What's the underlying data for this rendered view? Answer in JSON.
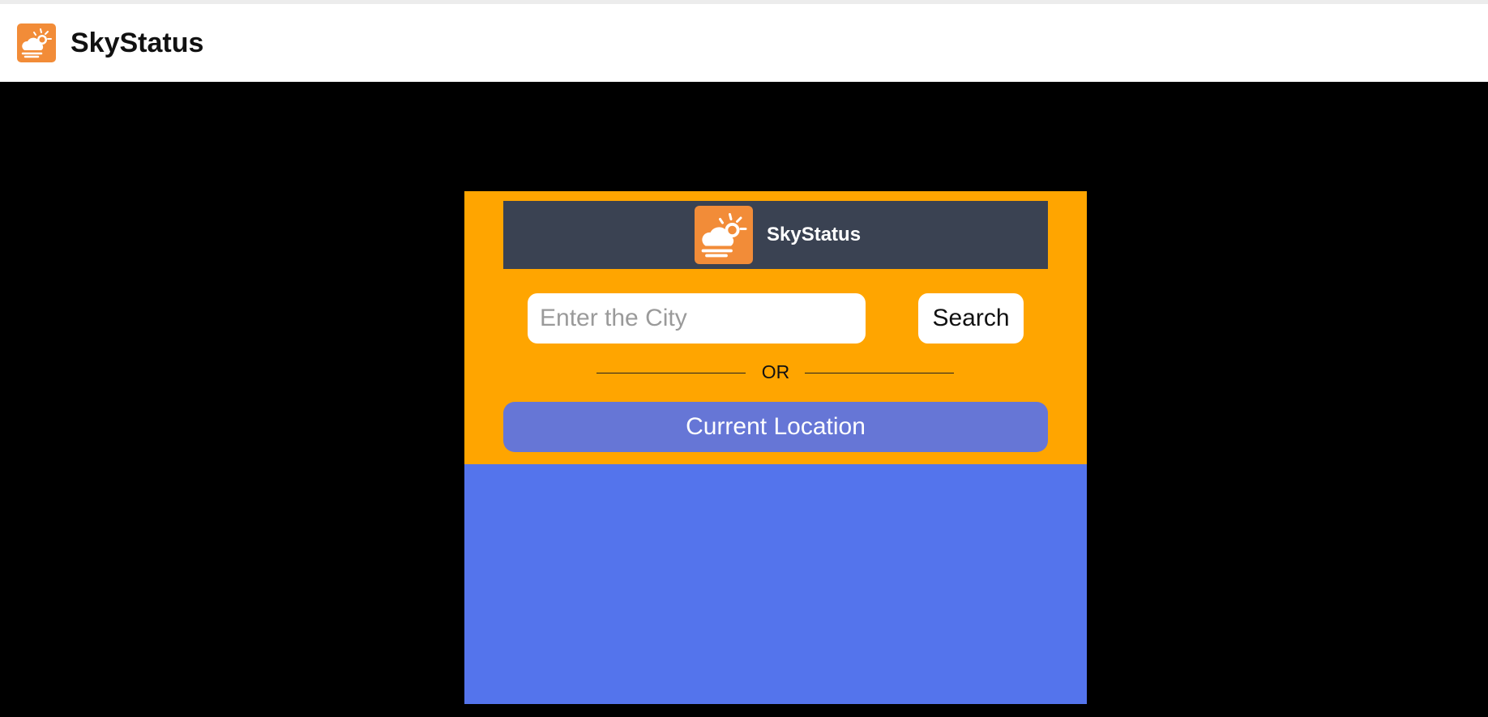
{
  "app": {
    "title": "SkyStatus",
    "logo_icon": "partly-cloudy-sun-icon"
  },
  "card": {
    "header_title": "SkyStatus",
    "search": {
      "placeholder": "Enter the City",
      "value": "",
      "button_label": "Search"
    },
    "divider_text": "OR",
    "location_button_label": "Current Location"
  },
  "colors": {
    "brand_orange": "#f28c38",
    "card_top_bg": "#ffa500",
    "card_header_bg": "#3a4252",
    "card_bottom_bg": "#5474ec",
    "location_button_bg": "#6676d6",
    "page_bg": "#000000"
  }
}
